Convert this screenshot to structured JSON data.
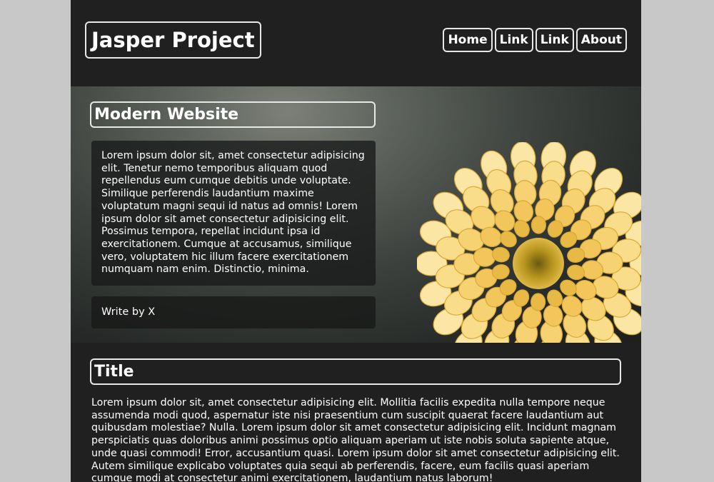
{
  "header": {
    "logo": "Jasper Project",
    "nav": [
      "Home",
      "Link",
      "Link",
      "About"
    ]
  },
  "hero": {
    "title": "Modern Website",
    "text": "Lorem ipsum dolor sit, amet consectetur adipisicing elit. Tenetur nemo temporibus aliquam quod repellendus eum cumque debitis unde voluptate. Similique perferendis laudantium maxime voluptatum magni sequi id natus ad omnis! Lorem ipsum dolor sit amet consectetur adipisicing elit. Possimus tempora, repellat incidunt ipsa id exercitationem. Cumque at accusamus, similique vero, voluptatem hic illum facere exercitationem numquam nam enim. Distinctio, minima.",
    "author": "Write by X",
    "image": "yellow-dahlia-flower"
  },
  "section": {
    "title": "Title",
    "text": "Lorem ipsum dolor sit, amet consectetur adipisicing elit. Mollitia facilis expedita nulla tempore neque assumenda modi quod, aspernatur iste nisi praesentium cum suscipit quaerat facere laudantium aut quibusdam molestiae? Nulla. Lorem ipsum dolor sit amet consectetur adipisicing elit. Incidunt magnam perspiciatis quas doloribus animi possimus optio aliquam aperiam ut iste nobis soluta sapiente atque, unde quasi commodi! Error, accusantium quasi. Lorem ipsum dolor sit amet consectetur adipisicing elit. Autem similique explicabo voluptates quia sequi ab perferendis, facere, eum facilis quasi aperiam cumque modi at consectetur animi exercitationem, laudantium natus laborum!"
  },
  "colors": {
    "page_background": "#c8c8c8",
    "content_background": "#202020",
    "text": "#ffffff",
    "border": "#e8e8e8",
    "flower": "#f7d77a"
  }
}
